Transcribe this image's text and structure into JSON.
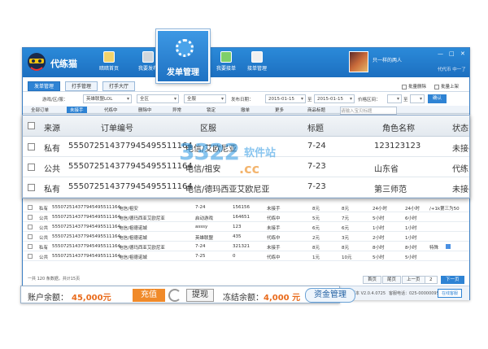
{
  "app": {
    "name": "代练猫",
    "nav": [
      {
        "label": "暗暗首页"
      },
      {
        "label": "我要发布"
      },
      {
        "label": "发单管理"
      },
      {
        "label": "我要接单"
      },
      {
        "label": "接单管理"
      }
    ],
    "user": {
      "name": "只一样的两人",
      "sub": "代代币 中一了"
    },
    "window_controls": [
      "—",
      "□",
      "✕"
    ]
  },
  "big_button": {
    "label": "发单管理"
  },
  "tabs": [
    {
      "label": "发单管理",
      "active": true
    },
    {
      "label": "打手管理",
      "active": false
    },
    {
      "label": "打手大厅",
      "active": false
    }
  ],
  "options": {
    "batch_delete": "批量删除",
    "batch_up": "批量上架"
  },
  "filter": {
    "game_label": "游戏/区/服：",
    "game_value": "英雄联盟LOL",
    "area_value": "全区",
    "server_value": "全服",
    "date_label": "发布日期：",
    "date_from": "2015-01-15",
    "date_sep": "至",
    "date_to": "2015-01-15",
    "price_label": "价格区间：",
    "price_sep": "至",
    "search_button": "确认"
  },
  "subtabs": [
    "全部订单",
    "未接手",
    "代练中",
    "删除中",
    "异常",
    "锁定",
    "撤单",
    "更多"
  ],
  "subtab_search_label": "商品标题",
  "subtab_search_placeholder": "请输入宝贝标题",
  "magnified_table": {
    "headers": [
      "来源",
      "订单编号",
      "区服",
      "标题",
      "角色名称",
      "状态"
    ],
    "rows": [
      {
        "source": "私有",
        "order": "555072514377945495511164",
        "server": "电信/艾欧尼亚",
        "title": "7-24",
        "role": "123123123",
        "status": "未接手"
      },
      {
        "source": "公共",
        "order": "555072514377945495511164",
        "server": "电信/祖安",
        "title": "7-23",
        "role": "山东省",
        "status": "代练中"
      },
      {
        "source": "私有",
        "order": "555072514377945495511164",
        "server": "电信/德玛西亚艾欧尼亚",
        "title": "7-23",
        "role": "第三师范",
        "status": "未接手"
      }
    ]
  },
  "small_rows": [
    {
      "source": "私有",
      "order": "555072514377945495511164",
      "server": "电信/祖安",
      "title": "7-24",
      "role": "156156",
      "status": "未接手",
      "price": "8元",
      "deposit": "8元",
      "time1": "24小时",
      "time2": "24小时",
      "extra": "/+1k第三为50"
    },
    {
      "source": "公共",
      "order": "555072514377945495511164",
      "server": "电信/德玛西亚艾欧尼亚",
      "title": "启动游戏",
      "role": "164651",
      "status": "代练中",
      "price": "5元",
      "deposit": "7元",
      "time1": "5小时",
      "time2": "6小时",
      "extra": ""
    },
    {
      "source": "公共",
      "order": "555072514377945495511164",
      "server": "电信/祖德诺城",
      "title": "asssy",
      "role": "123",
      "status": "未接手",
      "price": "6元",
      "deposit": "6元",
      "time1": "1小时",
      "time2": "1小时",
      "extra": ""
    },
    {
      "source": "公共",
      "order": "555072514377945495511164",
      "server": "电信/祖德诺城",
      "title": "英雄联盟",
      "role": "435",
      "status": "代练中",
      "price": "2元",
      "deposit": "3元",
      "time1": "2小时",
      "time2": "1小时",
      "extra": ""
    },
    {
      "source": "私有",
      "order": "555072514377945495511164",
      "server": "电信/德玛西亚艾欧尼亚",
      "title": "7-24",
      "role": "321321",
      "status": "未接手",
      "price": "8元",
      "deposit": "8元",
      "time1": "8小时",
      "time2": "8小时",
      "extra": "特殊"
    },
    {
      "source": "公共",
      "order": "555072514377945495511164",
      "server": "电信/祖德诺城",
      "title": "7-25",
      "role": "0",
      "status": "代练中",
      "price": "1元",
      "deposit": "10元",
      "time1": "5小时",
      "time2": "5小时",
      "extra": ""
    }
  ],
  "footer": {
    "page_info": "一共 120 条数据，共计15页",
    "first": "首页",
    "last": "尾页",
    "prev": "上一页",
    "page": "2",
    "next": "下一页",
    "version": "版本 V2.0.4.0725",
    "phone": "客服电话：025-00000095",
    "online": "在线客服"
  },
  "balance": {
    "account_label": "账户余额：",
    "account_value": "45,000元",
    "recharge": "充值",
    "withdraw": "提现",
    "frozen_label": "冻结余额：",
    "frozen_value": "4,000 元",
    "fund_manage": "资金管理"
  },
  "watermark": {
    "main": "3322",
    "site": "软件站",
    "domain": ".cc"
  },
  "colors": {
    "primary": "#2e83d4",
    "accent": "#f08a2a",
    "value": "#e96b1c"
  }
}
